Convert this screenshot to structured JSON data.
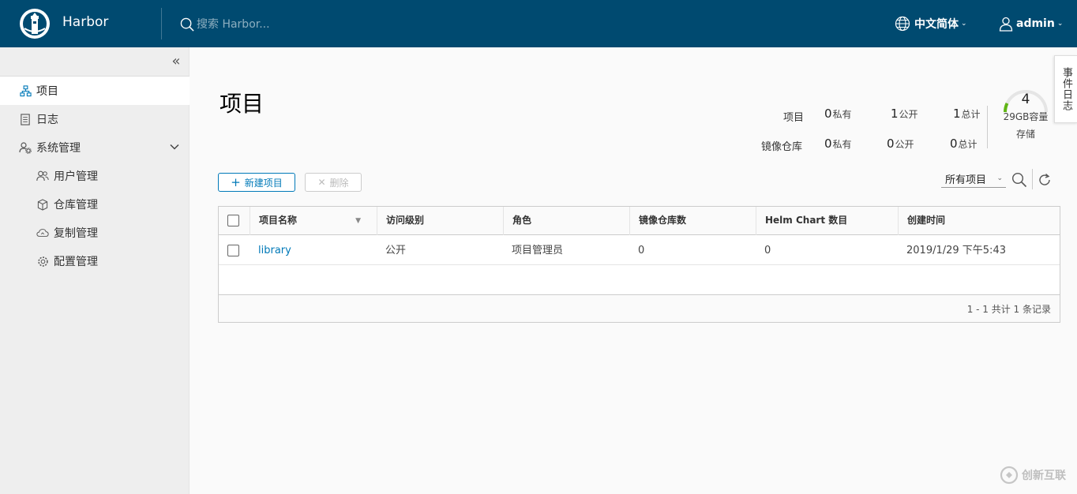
{
  "header": {
    "brand": "Harbor",
    "search_placeholder": "搜索 Harbor...",
    "language": "中文简体",
    "user": "admin"
  },
  "sidebar": {
    "items": [
      {
        "label": "项目",
        "icon": "project-icon"
      },
      {
        "label": "日志",
        "icon": "log-icon"
      },
      {
        "label": "系统管理",
        "icon": "admin-icon"
      }
    ],
    "sub_items": [
      {
        "label": "用户管理",
        "icon": "users-icon"
      },
      {
        "label": "仓库管理",
        "icon": "registry-icon"
      },
      {
        "label": "复制管理",
        "icon": "cloud-icon"
      },
      {
        "label": "配置管理",
        "icon": "gear-icon"
      }
    ]
  },
  "main": {
    "title": "项目",
    "stats": {
      "projects_label": "项目",
      "repos_label": "镜像仓库",
      "private_label": "私有",
      "public_label": "公开",
      "total_label": "总计",
      "projects_private": "0",
      "projects_public": "1",
      "projects_total": "1",
      "repos_private": "0",
      "repos_public": "0",
      "repos_total": "0"
    },
    "gauge": {
      "value": "4",
      "capacity": "29GB容量",
      "storage": "存储",
      "used_fraction": 0.14,
      "color": "#60b515"
    },
    "event_log_tab": "事件日志",
    "buttons": {
      "new_project": "新建项目",
      "delete": "删除"
    },
    "filter": {
      "selected": "所有项目"
    },
    "table": {
      "columns": [
        "项目名称",
        "访问级别",
        "角色",
        "镜像仓库数",
        "Helm Chart 数目",
        "创建时间"
      ],
      "rows": [
        {
          "name": "library",
          "access": "公开",
          "role": "项目管理员",
          "repo_count": "0",
          "chart_count": "0",
          "created": "2019/1/29 下午5:43"
        }
      ],
      "footer": "1 - 1 共计 1 条记录"
    }
  },
  "watermark": "创新互联",
  "colors": {
    "header_bg": "#004a70",
    "accent": "#0079b8",
    "sidebar_bg": "#eeeeee"
  }
}
